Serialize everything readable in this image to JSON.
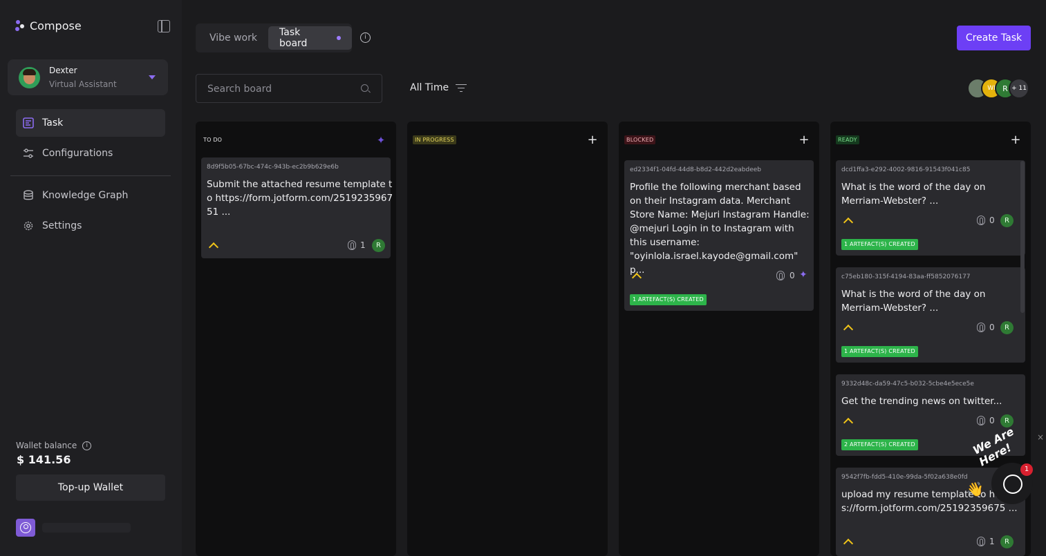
{
  "app": {
    "name": "Compose"
  },
  "agent": {
    "name": "Dexter",
    "role": "Virtual Assistant"
  },
  "nav": [
    {
      "label": "Task",
      "active": true
    },
    {
      "label": "Configurations"
    },
    {
      "label": "Knowledge Graph"
    },
    {
      "label": "Settings"
    }
  ],
  "wallet": {
    "label": "Wallet balance",
    "amount": "$ 141.56",
    "topup_label": "Top-up Wallet"
  },
  "tabs": {
    "vibe": "Vibe work",
    "board": "Task board"
  },
  "create_task_label": "Create Task",
  "search": {
    "placeholder": "Search board"
  },
  "filter": {
    "label": "All Time"
  },
  "avatars": {
    "first": "WI",
    "second": "R",
    "more": "+ 11"
  },
  "columns": [
    {
      "status": "TO DO",
      "cards": [
        {
          "id": "8d9f5b05-67bc-474c-943b-ec2b9b629e6b",
          "text": "Submit the attached resume template to https://form.jotform.com/251923596751 ...",
          "attachments": "1",
          "assignee": "R"
        }
      ]
    },
    {
      "status": "IN PROGRESS",
      "cards": []
    },
    {
      "status": "BLOCKED",
      "cards": [
        {
          "id": "ed2334f1-04fd-44d8-b8d2-442d2eabdeeb",
          "text": "Profile the following merchant based on their Instagram data. Merchant Store Name: Mejuri Instagram Handle: @mejuri Login in to Instagram with this username: \"oyinlola.israel.kayode@gmail.com\" p...",
          "attachments": "0",
          "artefacts": "1 ARTEFACT(S) CREATED"
        }
      ]
    },
    {
      "status": "READY",
      "cards": [
        {
          "id": "dcd1ffa3-e292-4002-9816-91543f041c85",
          "text": "What is the word of the day on Merriam-Webster? ...",
          "attachments": "0",
          "assignee": "R",
          "artefacts": "1 ARTEFACT(S) CREATED"
        },
        {
          "id": "c75eb180-315f-4194-83aa-ff5852076177",
          "text": "What is the word of the day on Merriam-Webster? ...",
          "attachments": "0",
          "assignee": "R",
          "artefacts": "1 ARTEFACT(S) CREATED"
        },
        {
          "id": "9332d48c-da59-47c5-b032-5cbe4e5ece5e",
          "text": "Get the trending news on twitter...",
          "attachments": "0",
          "assignee": "R",
          "artefacts": "2 ARTEFACT(S) CREATED"
        },
        {
          "id": "9542f7fb-fdd5-410e-99da-5f02a638e0fd",
          "text": "upload my resume template to https://form.jotform.com/25192359675 ...",
          "attachments": "1",
          "assignee": "R"
        }
      ]
    }
  ],
  "chat_widget": {
    "tagline": "We Are Here!",
    "badge": "1",
    "close": "×"
  },
  "colors": {
    "accent": "#6d3ff5",
    "ready": "#2db44a",
    "priority": "#f0c419",
    "blocked": "#3d1419"
  }
}
